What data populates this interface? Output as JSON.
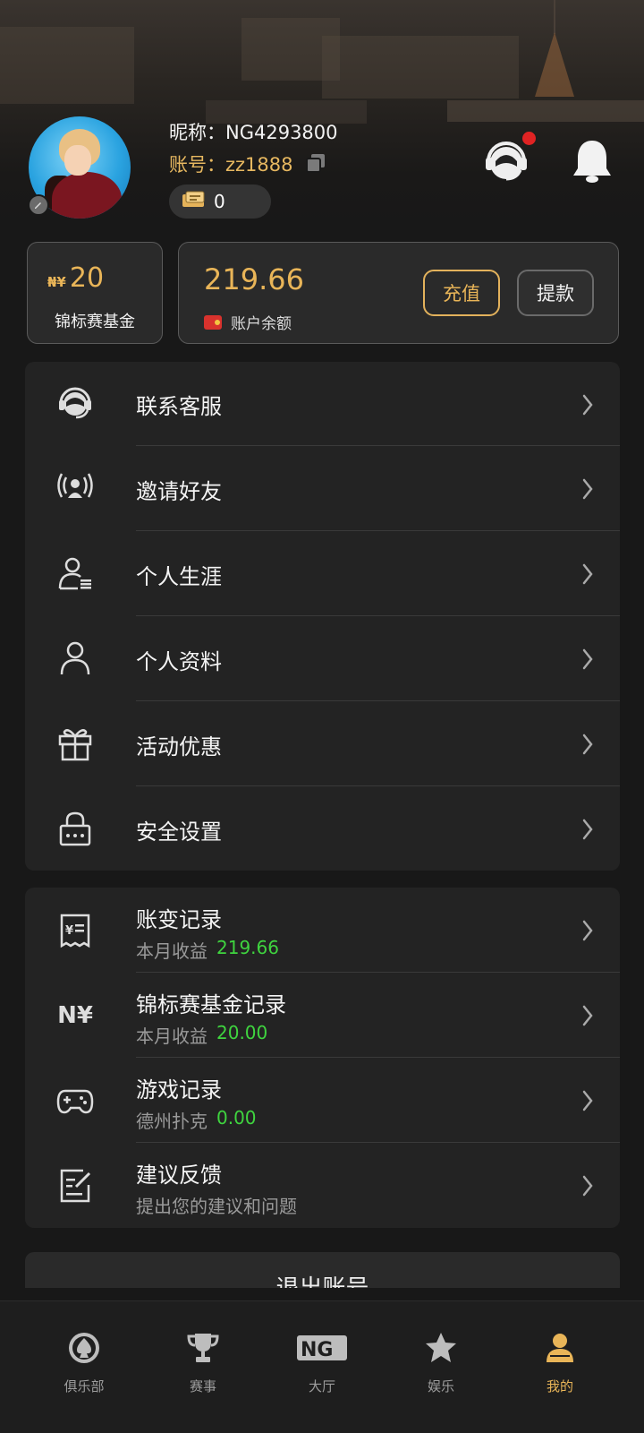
{
  "profile": {
    "nickname_label": "昵称：",
    "nickname": "NG4293800",
    "account_label": "账号：",
    "account": "zz1888",
    "ticket_count": "0"
  },
  "fund": {
    "currency": "₦¥",
    "amount": "20",
    "label": "锦标赛基金"
  },
  "balance": {
    "amount": "219.66",
    "label": "账户余额",
    "recharge": "充值",
    "withdraw": "提款"
  },
  "menu_main": [
    {
      "label": "联系客服",
      "icon": "customer-service-icon"
    },
    {
      "label": "邀请好友",
      "icon": "broadcast-user-icon"
    },
    {
      "label": "个人生涯",
      "icon": "user-list-icon"
    },
    {
      "label": "个人资料",
      "icon": "user-icon"
    },
    {
      "label": "活动优惠",
      "icon": "gift-icon"
    },
    {
      "label": "安全设置",
      "icon": "lock-icon"
    }
  ],
  "menu_records": [
    {
      "label": "账变记录",
      "sub_label": "本月收益",
      "sub_value": "219.66",
      "icon": "receipt-icon"
    },
    {
      "label": "锦标赛基金记录",
      "sub_label": "本月收益",
      "sub_value": "20.00",
      "icon": "currency-icon"
    },
    {
      "label": "游戏记录",
      "sub_label": "德州扑克",
      "sub_value": "0.00",
      "icon": "gamepad-icon"
    },
    {
      "label": "建议反馈",
      "sub_label": "提出您的建议和问题",
      "sub_value": "",
      "icon": "feedback-icon"
    }
  ],
  "currency_glyph": "N¥",
  "logout": "退出账号",
  "tabs": [
    {
      "label": "俱乐部",
      "icon": "spade-icon"
    },
    {
      "label": "赛事",
      "icon": "trophy-icon"
    },
    {
      "label": "大厅",
      "icon": "ng-logo-icon"
    },
    {
      "label": "娱乐",
      "icon": "star-icon"
    },
    {
      "label": "我的",
      "icon": "profile-icon",
      "active": true
    }
  ],
  "colors": {
    "accent": "#e9b558",
    "positive": "#3fd43f",
    "notification": "#e02323",
    "background": "#181818"
  }
}
